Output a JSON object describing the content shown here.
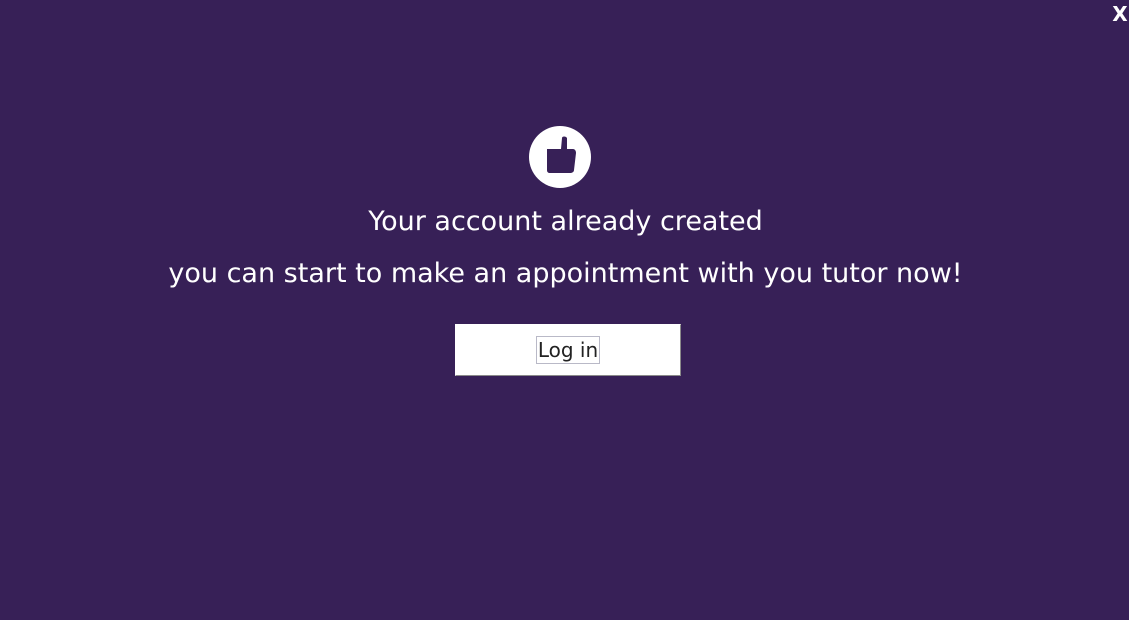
{
  "window": {
    "close_label": "X"
  },
  "message": {
    "icon": "thumbs-up-icon",
    "title": "Your account already created",
    "subtitle": "you can start to make an appointment with you tutor now!"
  },
  "actions": {
    "login_label": "Log in"
  },
  "colors": {
    "background": "#372057",
    "text": "#ffffff",
    "button_bg": "#ffffff",
    "button_text": "#222222"
  }
}
